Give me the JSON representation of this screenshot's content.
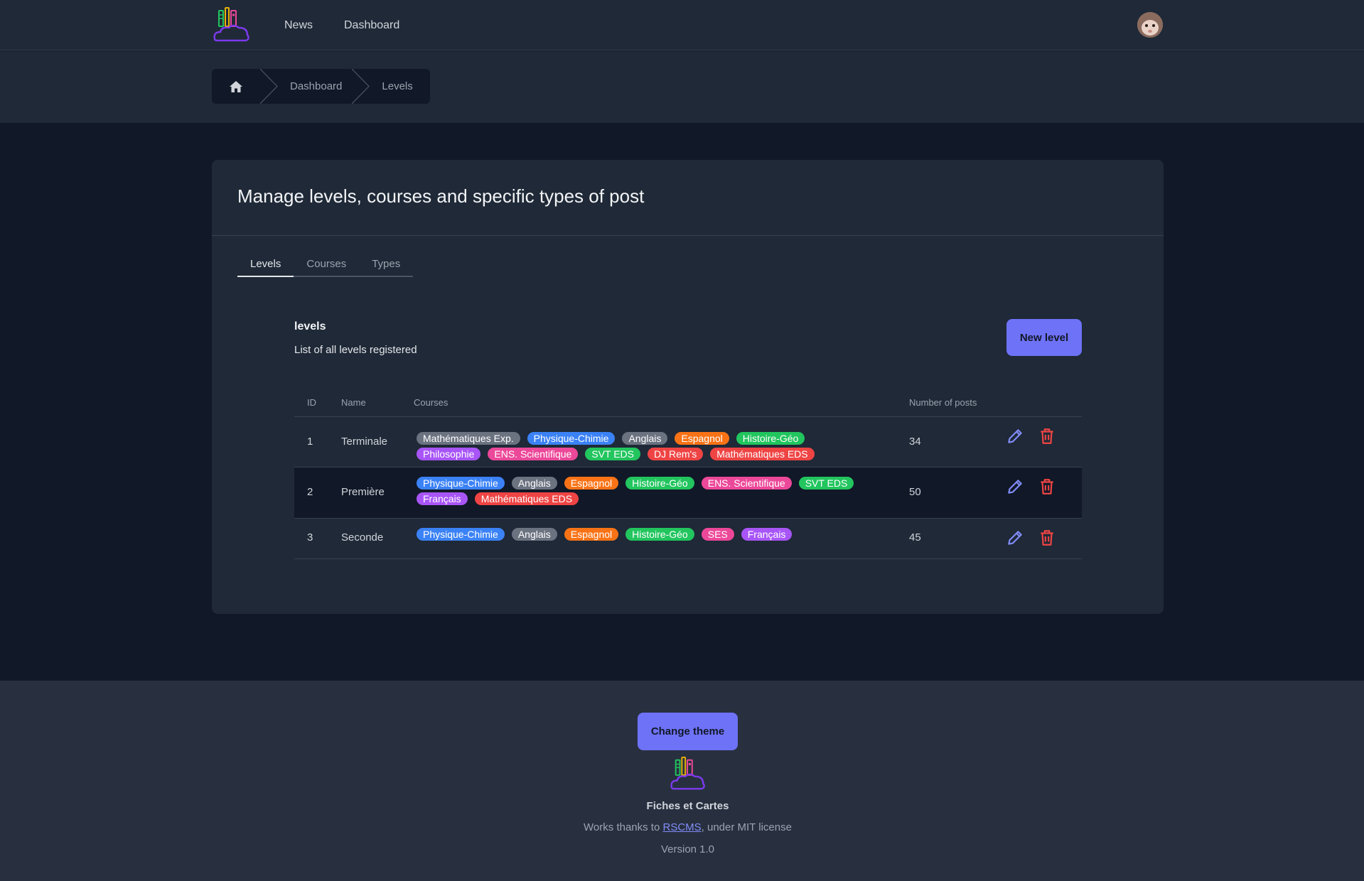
{
  "nav": {
    "links": [
      "News",
      "Dashboard"
    ]
  },
  "breadcrumb": {
    "items": [
      "Dashboard",
      "Levels"
    ]
  },
  "card": {
    "title": "Manage levels, courses and specific types of post",
    "tabs": [
      "Levels",
      "Courses",
      "Types"
    ],
    "active_tab": "Levels"
  },
  "section": {
    "title": "levels",
    "description": "List of all levels registered",
    "new_button": "New level"
  },
  "table": {
    "headers": [
      "ID",
      "Name",
      "Courses",
      "Number of posts"
    ],
    "rows": [
      {
        "id": "1",
        "name": "Terminale",
        "posts": "34",
        "courses": [
          {
            "label": "Mathématiques Exp.",
            "color": "#6b7280"
          },
          {
            "label": "Physique-Chimie",
            "color": "#3b82f6"
          },
          {
            "label": "Anglais",
            "color": "#6b7280"
          },
          {
            "label": "Espagnol",
            "color": "#f97316"
          },
          {
            "label": "Histoire-Géo",
            "color": "#22c55e"
          },
          {
            "label": "Philosophie",
            "color": "#a855f7"
          },
          {
            "label": "ENS. Scientifique",
            "color": "#ec4899"
          },
          {
            "label": "SVT EDS",
            "color": "#22c55e"
          },
          {
            "label": "DJ Rem's",
            "color": "#ef4444"
          },
          {
            "label": "Mathématiques EDS",
            "color": "#ef4444"
          }
        ]
      },
      {
        "id": "2",
        "name": "Première",
        "posts": "50",
        "courses": [
          {
            "label": "Physique-Chimie",
            "color": "#3b82f6"
          },
          {
            "label": "Anglais",
            "color": "#6b7280"
          },
          {
            "label": "Espagnol",
            "color": "#f97316"
          },
          {
            "label": "Histoire-Géo",
            "color": "#22c55e"
          },
          {
            "label": "ENS. Scientifique",
            "color": "#ec4899"
          },
          {
            "label": "SVT EDS",
            "color": "#22c55e"
          },
          {
            "label": "Français",
            "color": "#a855f7"
          },
          {
            "label": "Mathématiques EDS",
            "color": "#ef4444"
          }
        ]
      },
      {
        "id": "3",
        "name": "Seconde",
        "posts": "45",
        "courses": [
          {
            "label": "Physique-Chimie",
            "color": "#3b82f6"
          },
          {
            "label": "Anglais",
            "color": "#6b7280"
          },
          {
            "label": "Espagnol",
            "color": "#f97316"
          },
          {
            "label": "Histoire-Géo",
            "color": "#22c55e"
          },
          {
            "label": "SES",
            "color": "#ec4899"
          },
          {
            "label": "Français",
            "color": "#a855f7"
          }
        ]
      }
    ]
  },
  "footer": {
    "theme_button": "Change theme",
    "site_name": "Fiches et Cartes",
    "credit_prefix": "Works thanks to ",
    "credit_link": "RSCMS",
    "credit_suffix": ", under MIT license",
    "version": "Version 1.0"
  },
  "colors": {
    "accent": "#6e72f6",
    "edit_icon": "#818cf8",
    "delete_icon": "#ef4444"
  },
  "icons": {
    "home": "home-icon",
    "edit": "pencil-icon",
    "delete": "trash-icon"
  }
}
